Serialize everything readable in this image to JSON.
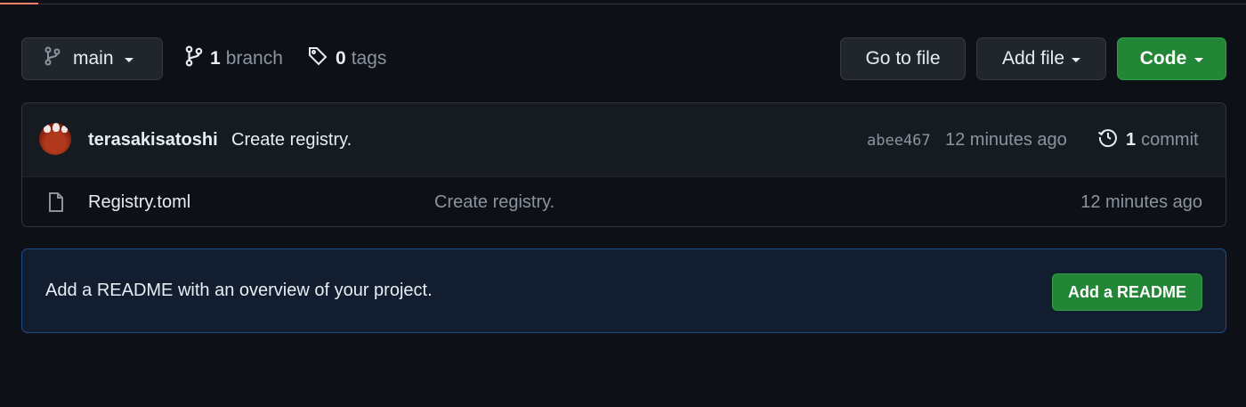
{
  "toolbar": {
    "branch_select": {
      "label": "main"
    },
    "branches": {
      "count": "1",
      "label": "branch"
    },
    "tags": {
      "count": "0",
      "label": "tags"
    },
    "go_to_file": "Go to file",
    "add_file": "Add file",
    "code": "Code"
  },
  "latest_commit": {
    "author": "terasakisatoshi",
    "message": "Create registry.",
    "sha": "abee467",
    "time": "12 minutes ago",
    "commit_count": "1",
    "commit_label": "commit"
  },
  "files": [
    {
      "name": "Registry.toml",
      "message": "Create registry.",
      "time": "12 minutes ago",
      "icon": "file-icon"
    }
  ],
  "readme_banner": {
    "text": "Add a README with an overview of your project.",
    "button": "Add a README"
  },
  "colors": {
    "background": "#0d1117",
    "primary_button": "#238636",
    "banner_background": "#121d2f",
    "banner_border": "#1f4d87",
    "tab_accent": "#f78166"
  }
}
